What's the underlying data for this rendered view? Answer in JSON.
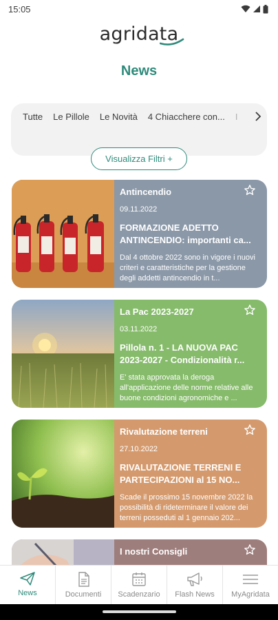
{
  "status_bar": {
    "time": "15:05"
  },
  "app": {
    "logo_text": "agridata",
    "page_title": "News"
  },
  "categories": [
    "Tutte",
    "Le Pillole",
    "Le Novità",
    "4 Chiacchere con...",
    "I"
  ],
  "filters_button_label": "Visualizza Filtri +",
  "news": [
    {
      "category": "Antincendio",
      "date": "09.11.2022",
      "title": "FORMAZIONE ADETTO ANTINCENDIO: importanti ca...",
      "excerpt": "Dal 4 ottobre 2022 sono in vigore i nuovi criteri e caratteristiche per la gestione degli addetti antincendio in t...",
      "color": "#8b98a8",
      "image": "fire-extinguishers"
    },
    {
      "category": "La Pac 2023-2027",
      "date": "03.11.2022",
      "title": "Pillola n. 1 - LA NUOVA PAC 2023-2027 - Condizionalità r...",
      "excerpt": "E' stata approvata la deroga all'applicazione delle norme relative alle buone condizioni agronomiche e ...",
      "color": "#86bb6b",
      "image": "wheat-field-sunset"
    },
    {
      "category": "Rivalutazione terreni",
      "date": "27.10.2022",
      "title": "RIVALUTAZIONE TERRENI E PARTECIPAZIONI al 15 NO...",
      "excerpt": "Scade il prossimo 15 novembre 2022 la possibilità di rideterminare il valore dei terreni posseduti al 1 gennaio 202...",
      "color": "#d49a6e",
      "image": "seedling"
    },
    {
      "category": "I nostri Consigli",
      "date": "",
      "title": "",
      "excerpt": "",
      "color": "#9e7e7c",
      "image": "hand-writing"
    }
  ],
  "tabs": [
    {
      "label": "News",
      "icon": "paper-plane-icon",
      "active": true
    },
    {
      "label": "Documenti",
      "icon": "document-icon",
      "active": false
    },
    {
      "label": "Scadenzario",
      "icon": "calendar-icon",
      "active": false
    },
    {
      "label": "Flash News",
      "icon": "megaphone-icon",
      "active": false
    },
    {
      "label": "MyAgridata",
      "icon": "menu-icon",
      "active": false
    }
  ],
  "colors": {
    "accent": "#2e8a7a",
    "tab_inactive": "#8a8a8a"
  }
}
